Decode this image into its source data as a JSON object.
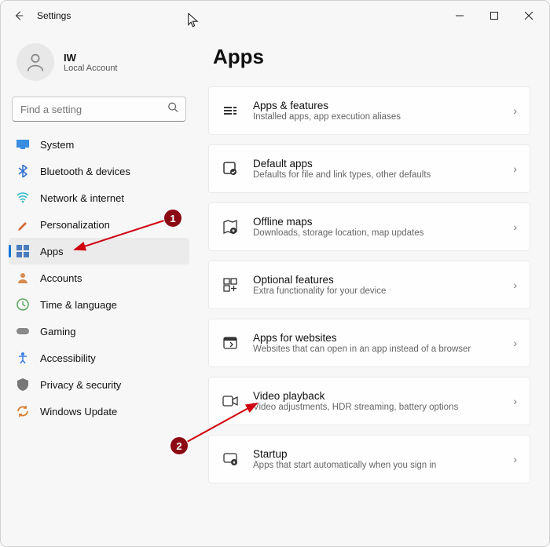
{
  "window": {
    "title": "Settings"
  },
  "profile": {
    "name": "IW",
    "type": "Local Account"
  },
  "search": {
    "placeholder": "Find a setting"
  },
  "sidebar": {
    "items": [
      {
        "label": "System",
        "icon": "system"
      },
      {
        "label": "Bluetooth & devices",
        "icon": "bluetooth"
      },
      {
        "label": "Network & internet",
        "icon": "network"
      },
      {
        "label": "Personalization",
        "icon": "personalization"
      },
      {
        "label": "Apps",
        "icon": "apps",
        "active": true
      },
      {
        "label": "Accounts",
        "icon": "accounts"
      },
      {
        "label": "Time & language",
        "icon": "time"
      },
      {
        "label": "Gaming",
        "icon": "gaming"
      },
      {
        "label": "Accessibility",
        "icon": "accessibility"
      },
      {
        "label": "Privacy & security",
        "icon": "privacy"
      },
      {
        "label": "Windows Update",
        "icon": "update"
      }
    ]
  },
  "page": {
    "title": "Apps"
  },
  "cards": [
    {
      "title": "Apps & features",
      "sub": "Installed apps, app execution aliases",
      "icon": "apps-features"
    },
    {
      "title": "Default apps",
      "sub": "Defaults for file and link types, other defaults",
      "icon": "default-apps"
    },
    {
      "title": "Offline maps",
      "sub": "Downloads, storage location, map updates",
      "icon": "offline-maps"
    },
    {
      "title": "Optional features",
      "sub": "Extra functionality for your device",
      "icon": "optional-features"
    },
    {
      "title": "Apps for websites",
      "sub": "Websites that can open in an app instead of a browser",
      "icon": "apps-websites"
    },
    {
      "title": "Video playback",
      "sub": "Video adjustments, HDR streaming, battery options",
      "icon": "video"
    },
    {
      "title": "Startup",
      "sub": "Apps that start automatically when you sign in",
      "icon": "startup"
    }
  ],
  "annotations": {
    "marker1": "1",
    "marker2": "2"
  }
}
